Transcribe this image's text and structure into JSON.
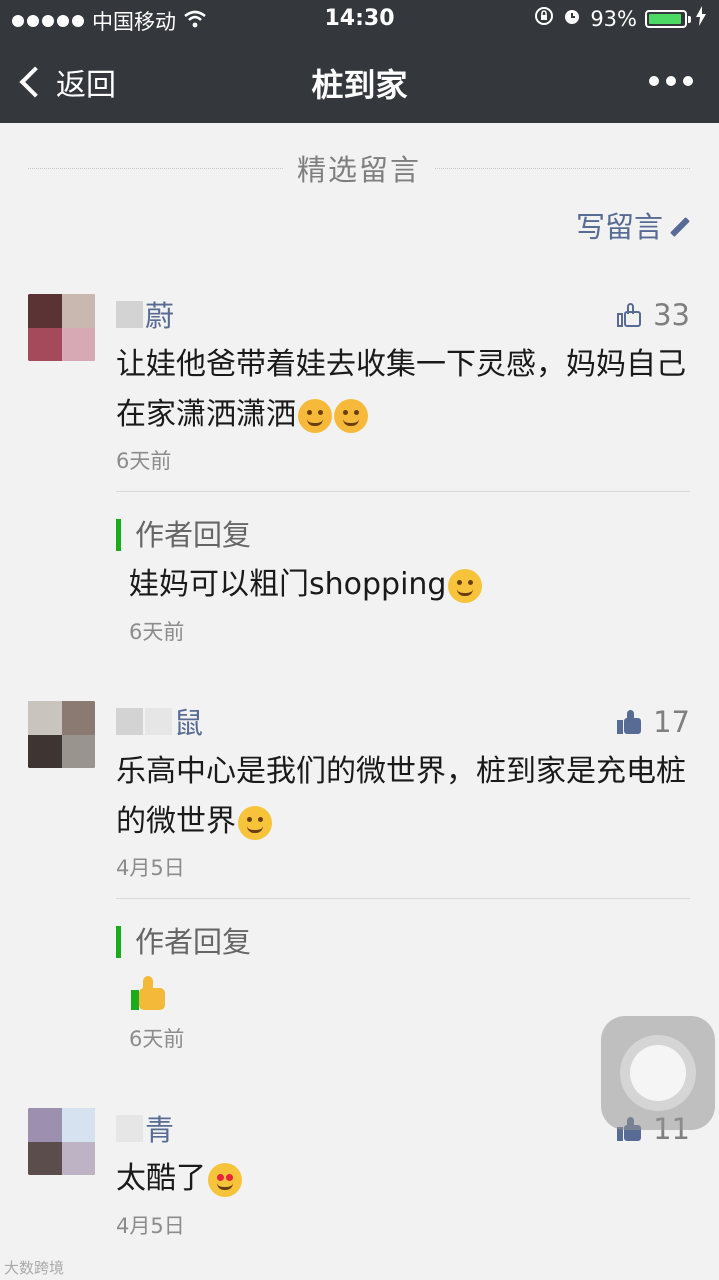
{
  "status_bar": {
    "carrier": "中国移动",
    "time": "14:30",
    "battery_percent": "93%",
    "battery_level": 0.93,
    "icons": [
      "wifi-icon",
      "orientation-lock-icon",
      "alarm-icon",
      "charging-icon"
    ]
  },
  "nav": {
    "back_label": "返回",
    "title": "桩到家"
  },
  "section": {
    "title": "精选留言",
    "write_label": "写留言"
  },
  "comments": [
    {
      "name_suffix": "蔚",
      "likes": "33",
      "liked": false,
      "text": "让娃他爸带着娃去收集一下灵感，妈妈自己在家潇洒潇洒",
      "date": "6天前",
      "reply": {
        "label": "作者回复",
        "text": "娃妈可以粗门shopping",
        "date": "6天前"
      }
    },
    {
      "name_suffix": "鼠",
      "likes": "17",
      "liked": true,
      "text": "乐高中心是我们的微世界，桩到家是充电桩的微世界",
      "date": "4月5日",
      "reply": {
        "label": "作者回复",
        "text": "",
        "date": "6天前"
      }
    },
    {
      "name_suffix": "青",
      "likes": "11",
      "liked": true,
      "text": "太酷了",
      "date": "4月5日"
    }
  ],
  "watermark": "大数跨境",
  "colors": {
    "header_bg": "#34373b",
    "link_blue": "#576b95",
    "reply_green": "#1aad19",
    "page_bg": "#f2f2f2"
  }
}
